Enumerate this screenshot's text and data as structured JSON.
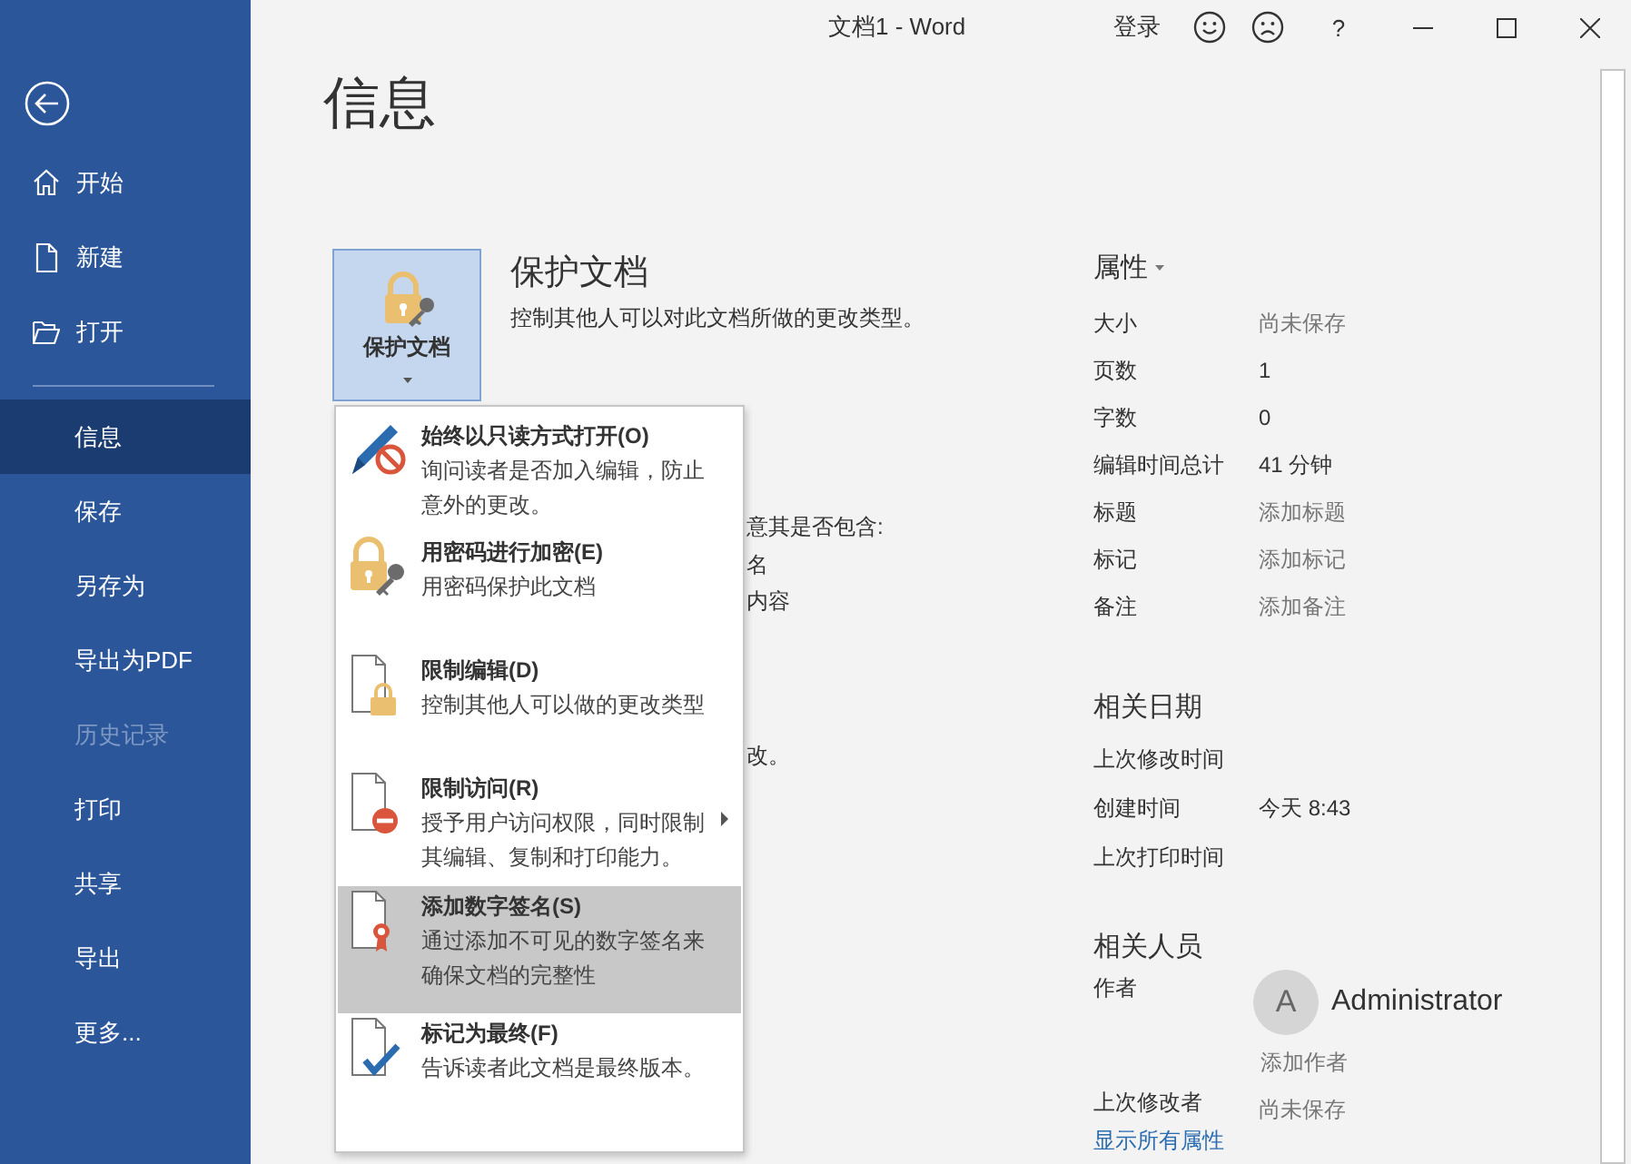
{
  "window": {
    "title": "文档1  -  Word",
    "sign_in": "登录",
    "help": "?"
  },
  "sidebar": {
    "top_items": [
      {
        "label": "开始",
        "kind": "home"
      },
      {
        "label": "新建",
        "kind": "new"
      },
      {
        "label": "打开",
        "kind": "open"
      }
    ],
    "items": [
      {
        "label": "信息",
        "selected": true,
        "disabled": false
      },
      {
        "label": "保存",
        "selected": false,
        "disabled": false
      },
      {
        "label": "另存为",
        "selected": false,
        "disabled": false
      },
      {
        "label": "导出为PDF",
        "selected": false,
        "disabled": false
      },
      {
        "label": "历史记录",
        "selected": false,
        "disabled": true
      },
      {
        "label": "打印",
        "selected": false,
        "disabled": false
      },
      {
        "label": "共享",
        "selected": false,
        "disabled": false
      },
      {
        "label": "导出",
        "selected": false,
        "disabled": false
      },
      {
        "label": "更多...",
        "selected": false,
        "disabled": false
      }
    ]
  },
  "heading": "信息",
  "protect": {
    "button_label": "保护文档",
    "title": "保护文档",
    "description": "控制其他人可以对此文档所做的更改类型。"
  },
  "protect_menu": [
    {
      "kind": "readonly",
      "title": "始终以只读方式打开(O)",
      "description": "询问读者是否加入编辑，防止意外的更改。",
      "highlighted": false,
      "submenu": false
    },
    {
      "kind": "encrypt",
      "title": "用密码进行加密(E)",
      "description": "用密码保护此文档",
      "highlighted": false,
      "submenu": false
    },
    {
      "kind": "restrict_edit",
      "title": "限制编辑(D)",
      "description": "控制其他人可以做的更改类型",
      "highlighted": false,
      "submenu": false
    },
    {
      "kind": "restrict_access",
      "title": "限制访问(R)",
      "description": "授予用户访问权限，同时限制其编辑、复制和打印能力。",
      "highlighted": false,
      "submenu": true
    },
    {
      "kind": "signature",
      "title": "添加数字签名(S)",
      "description": "通过添加不可见的数字签名来确保文档的完整性",
      "highlighted": true,
      "submenu": false
    },
    {
      "kind": "final",
      "title": "标记为最终(F)",
      "description": "告诉读者此文档是最终版本。",
      "highlighted": false,
      "submenu": false
    }
  ],
  "obscured_texts": [
    "意其是否包含:",
    "名",
    "内容",
    "改。"
  ],
  "properties": {
    "title": "属性",
    "rows": [
      {
        "label": "大小",
        "value": "尚未保存",
        "kind": "placeholder"
      },
      {
        "label": "页数",
        "value": "1",
        "kind": "value"
      },
      {
        "label": "字数",
        "value": "0",
        "kind": "value"
      },
      {
        "label": "编辑时间总计",
        "value": "41 分钟",
        "kind": "value"
      },
      {
        "label": "标题",
        "value": "添加标题",
        "kind": "placeholder"
      },
      {
        "label": "标记",
        "value": "添加标记",
        "kind": "placeholder"
      },
      {
        "label": "备注",
        "value": "添加备注",
        "kind": "placeholder"
      }
    ]
  },
  "related_dates": {
    "title": "相关日期",
    "rows": [
      {
        "label": "上次修改时间"
      },
      {
        "label": "创建时间",
        "value": "今天 8:43"
      },
      {
        "label": "上次打印时间"
      }
    ]
  },
  "related_people": {
    "title": "相关人员",
    "author_label": "作者",
    "author": {
      "initial": "A",
      "name": "Administrator"
    },
    "add_author": "添加作者",
    "last_modified_by_label": "上次修改者",
    "last_modified_by": "尚未保存"
  },
  "show_all_link": "显示所有属性"
}
